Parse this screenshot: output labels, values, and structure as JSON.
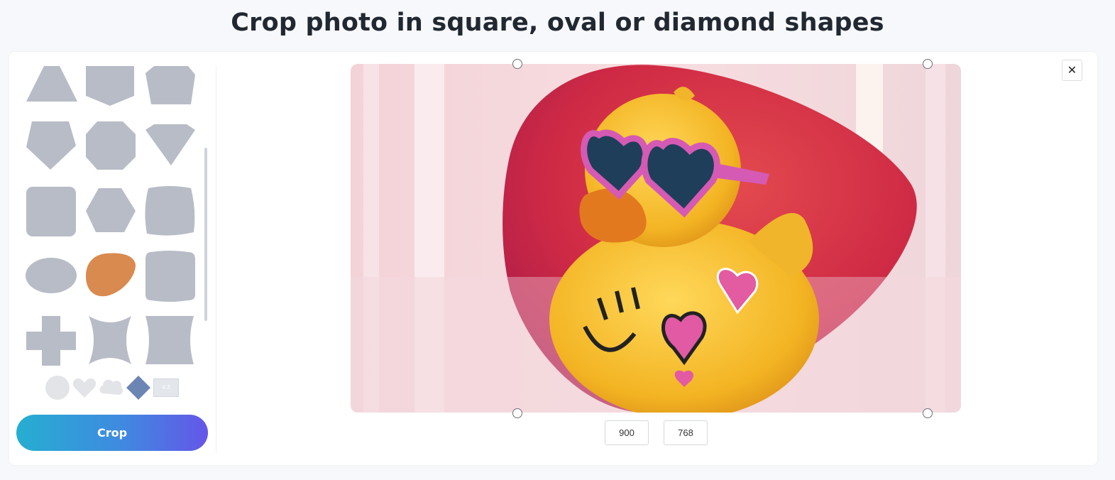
{
  "page": {
    "title": "Crop photo in square, oval or diamond shapes"
  },
  "colors": {
    "shape_default": "#b8bcc6",
    "shape_selected": "#d98a4e",
    "crop_gradient": [
      "#26aed1",
      "#6456e8"
    ],
    "page_background": "#f6f8fb"
  },
  "sidebar": {
    "shapes": [
      {
        "name": "trapezoid",
        "selected": false
      },
      {
        "name": "pentagon-down",
        "selected": false
      },
      {
        "name": "irregular-pentagon",
        "selected": false
      },
      {
        "name": "pentagon",
        "selected": false
      },
      {
        "name": "octagon",
        "selected": false
      },
      {
        "name": "gem",
        "selected": false
      },
      {
        "name": "rounded-square",
        "selected": false
      },
      {
        "name": "hexagon",
        "selected": false
      },
      {
        "name": "wavy-square",
        "selected": false
      },
      {
        "name": "ellipse",
        "selected": false
      },
      {
        "name": "blob-triangle",
        "selected": true
      },
      {
        "name": "rounded-rectangle",
        "selected": false
      },
      {
        "name": "cross",
        "selected": false
      },
      {
        "name": "concave-star",
        "selected": false
      },
      {
        "name": "concave-rectangle",
        "selected": false
      }
    ],
    "extra_shapes": [
      "circle-icon",
      "heart-icon",
      "cloud-icon",
      "diamond-icon",
      "aspect-ratio-icon"
    ],
    "ratio_label": "4:3",
    "crop_label": "Crop"
  },
  "editor": {
    "width_value": "900",
    "height_value": "768",
    "close_symbol": "✕",
    "image": "rubber-duck-with-heart-sunglasses"
  }
}
